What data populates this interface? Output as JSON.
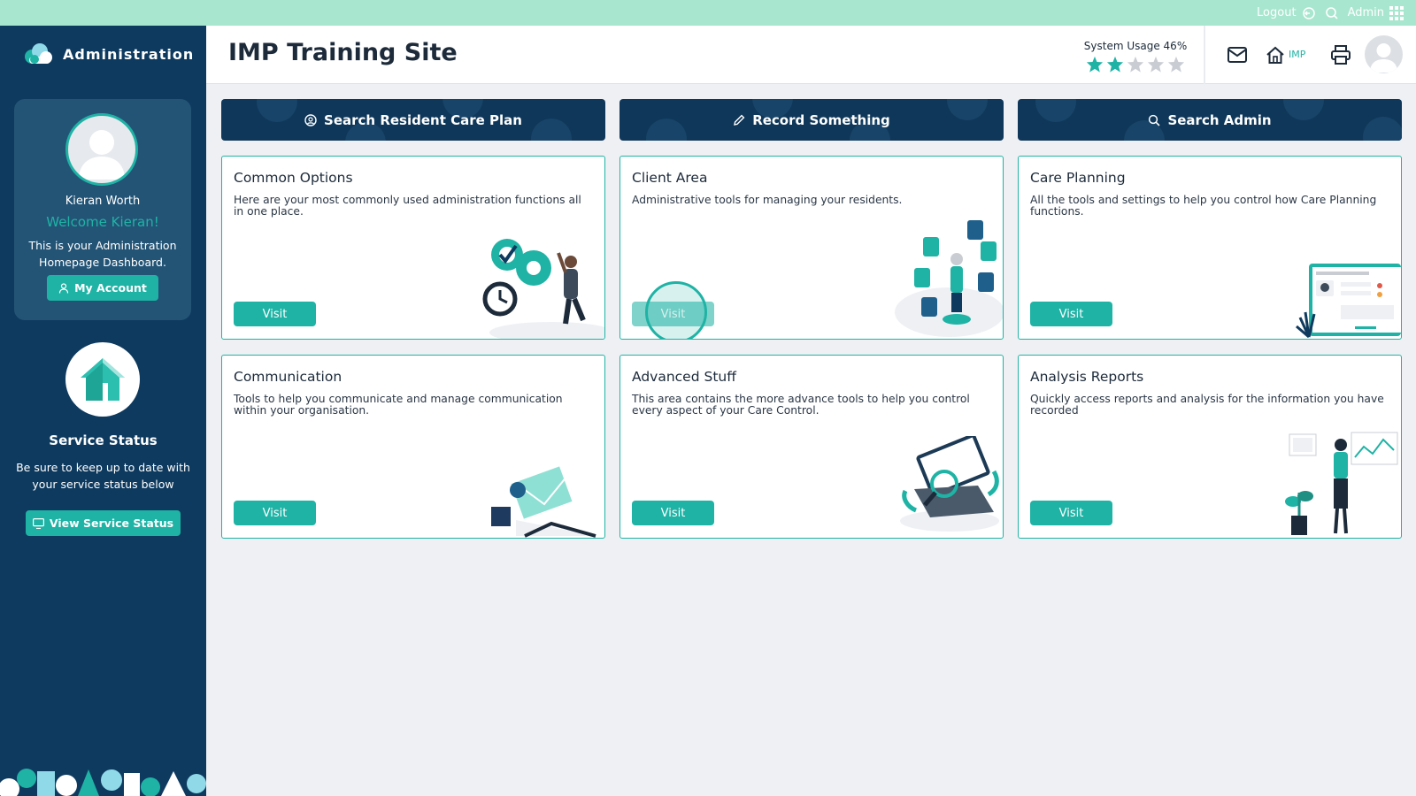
{
  "topbar": {
    "logout": "Logout",
    "admin": "Admin"
  },
  "sidebar": {
    "brand": "Administration",
    "profile": {
      "name": "Kieran Worth",
      "welcome": "Welcome Kieran!",
      "description": "This is your Administration Homepage Dashboard.",
      "my_account": "My Account"
    },
    "service": {
      "title": "Service Status",
      "description": "Be sure to keep up to date with your service status below",
      "button": "View Service Status"
    }
  },
  "header": {
    "title": "IMP Training Site",
    "usage_label": "System Usage 46%",
    "usage_percent": 46,
    "stars_filled": 2,
    "stars_total": 5,
    "home_label": "IMP"
  },
  "actions": [
    {
      "label": "Search Resident Care Plan",
      "icon": "care-plan-icon"
    },
    {
      "label": "Record Something",
      "icon": "pencil-icon"
    },
    {
      "label": "Search Admin",
      "icon": "search-icon"
    }
  ],
  "cards": [
    {
      "title": "Common Options",
      "description": "Here are your most commonly used administration functions all in one place.",
      "button": "Visit"
    },
    {
      "title": "Client Area",
      "description": "Administrative tools for managing your residents.",
      "button": "Visit"
    },
    {
      "title": "Care Planning",
      "description": "All the tools and settings to help you control how Care Planning functions.",
      "button": "Visit"
    },
    {
      "title": "Communication",
      "description": "Tools to help you communicate and manage communication within your organisation.",
      "button": "Visit"
    },
    {
      "title": "Advanced Stuff",
      "description": "This area contains the more advance tools to help you control every aspect of your Care Control.",
      "button": "Visit"
    },
    {
      "title": "Analysis Reports",
      "description": "Quickly access reports and analysis for the information you have recorded",
      "button": "Visit"
    }
  ],
  "colors": {
    "accent": "#1fb3a5",
    "sidebar": "#0e3a5f",
    "topbar": "#a8e6cf",
    "action": "#0f3759"
  }
}
